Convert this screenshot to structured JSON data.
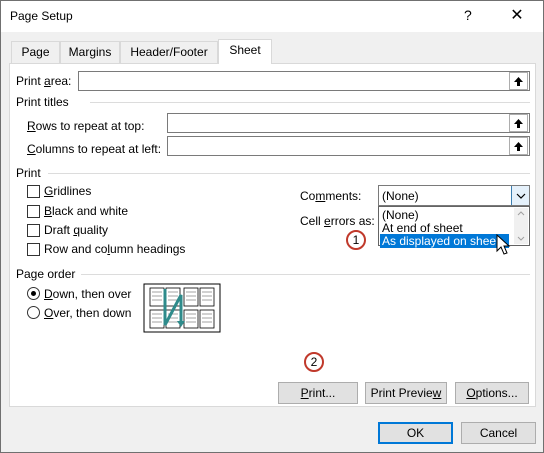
{
  "window": {
    "title": "Page Setup",
    "help": "?",
    "close": "✕"
  },
  "tabs": [
    "Page",
    "Margins",
    "Header/Footer",
    "Sheet"
  ],
  "print_area": {
    "label_pre": "Print ",
    "label_u": "a",
    "label_post": "rea:",
    "value": ""
  },
  "print_titles": {
    "heading": "Print titles",
    "rows": {
      "label_u": "R",
      "label_post": "ows to repeat at top:",
      "value": ""
    },
    "cols": {
      "label_u": "C",
      "label_post": "olumns to repeat at left:",
      "value": ""
    }
  },
  "print": {
    "heading": "Print",
    "checkboxes": [
      {
        "u": "G",
        "rest": "ridlines",
        "checked": false
      },
      {
        "u": "B",
        "rest": "lack and white",
        "checked": false
      },
      {
        "pre": "Draft ",
        "u": "q",
        "rest": "uality",
        "checked": false
      },
      {
        "pre": "Row and co",
        "u": "l",
        "rest": "umn headings",
        "checked": false
      }
    ],
    "comments": {
      "label_pre": "Co",
      "label_u": "m",
      "label_post": "ments:",
      "value": "(None)"
    },
    "cell_errors": {
      "label_pre": "Cell ",
      "label_u": "e",
      "label_post": "rrors as:"
    },
    "dropdown_options": [
      "(None)",
      "At end of sheet",
      "As displayed on sheet"
    ],
    "dropdown_selected": "As displayed on sheet"
  },
  "page_order": {
    "heading": "Page order",
    "options": [
      {
        "u": "D",
        "rest": "own, then over",
        "selected": true
      },
      {
        "u": "O",
        "rest": "ver, then down",
        "selected": false
      }
    ]
  },
  "buttons": {
    "print": {
      "u": "P",
      "rest": "rint..."
    },
    "preview": {
      "pre": "Print Previe",
      "u": "w",
      "rest": ""
    },
    "options": {
      "u": "O",
      "rest": "ptions..."
    },
    "ok": "OK",
    "cancel": "Cancel"
  },
  "callouts": [
    "1",
    "2"
  ],
  "colors": {
    "accent": "#0078d7",
    "callout": "#c0392b"
  }
}
